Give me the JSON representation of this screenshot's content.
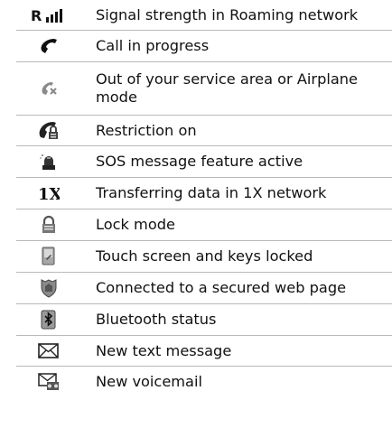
{
  "rows": [
    {
      "icon": "roaming-signal-icon",
      "label": "Signal strength in Roaming network"
    },
    {
      "icon": "call-in-progress-icon",
      "label": "Call in progress"
    },
    {
      "icon": "no-service-airplane-icon",
      "label": "Out of your service area or Airplane mode"
    },
    {
      "icon": "restriction-on-icon",
      "label": "Restriction on"
    },
    {
      "icon": "sos-message-icon",
      "label": "SOS message feature active"
    },
    {
      "icon": "1x-data-icon",
      "label": "Transferring data in 1X network"
    },
    {
      "icon": "lock-mode-icon",
      "label": "Lock mode"
    },
    {
      "icon": "touch-keys-locked-icon",
      "label": "Touch screen and keys locked"
    },
    {
      "icon": "secured-web-page-icon",
      "label": "Connected to a secured web page"
    },
    {
      "icon": "bluetooth-status-icon",
      "label": "Bluetooth status"
    },
    {
      "icon": "new-text-message-icon",
      "label": "New text message"
    },
    {
      "icon": "new-voicemail-icon",
      "label": "New voicemail"
    }
  ],
  "icon_texts": {
    "roaming_letter": "R",
    "onex": "1X"
  }
}
